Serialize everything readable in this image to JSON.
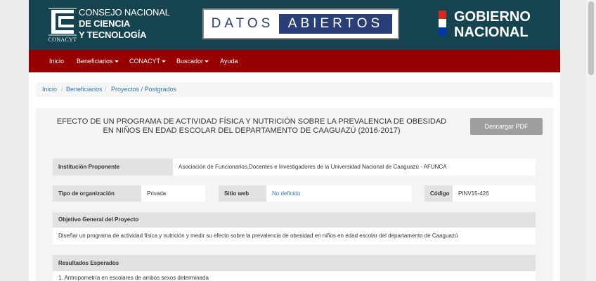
{
  "header": {
    "conacyt": {
      "line1": "CONSEJO NACIONAL",
      "line2": "DE CIENCIA",
      "line3": "Y TECNOLOGÍA",
      "abbr": "CONACYT"
    },
    "datos_abiertos": {
      "datos": "DATOS",
      "abiertos": "ABIERTOS"
    },
    "gobierno": {
      "line1": "GOBIERNO",
      "line2": "NACIONAL"
    }
  },
  "nav": {
    "items": [
      {
        "label": "Inicio",
        "dropdown": false
      },
      {
        "label": "Beneficiarios",
        "dropdown": true
      },
      {
        "label": "CONACYT",
        "dropdown": true
      },
      {
        "label": "Buscador",
        "dropdown": true
      },
      {
        "label": "Ayuda",
        "dropdown": false
      }
    ]
  },
  "breadcrumb": {
    "items": [
      "Inicio",
      "Beneficiarios",
      "Proyectos / Postgrados"
    ],
    "separator": "/"
  },
  "project": {
    "title_line1": "EFECTO DE UN PROGRAMA DE ACTIVIDAD FÍSICA Y NUTRICIÓN SOBRE LA PREVALENCIA DE OBESIDAD",
    "title_line2": "EN NIÑOS EN EDAD ESCOLAR DEL DEPARTAMENTO DE CAAGUAZÚ (2016-2017)",
    "download_label": "Descargar PDF"
  },
  "fields": {
    "institucion": {
      "label": "Institución Proponente",
      "value": "Asociación de Funcionarios,Docentes e Investigadores de la Universidad Nacional de Caaguazú - AFUNCA"
    },
    "tipo": {
      "label": "Tipo de organización",
      "value": "Privada"
    },
    "sitio": {
      "label": "Sitio web",
      "value": "No definido"
    },
    "codigo": {
      "label": "Código",
      "value": "PINV15-426"
    },
    "objetivo": {
      "label": "Objetivo General del Proyecto",
      "value": "Diseñar un programa de actividad física y nutrición y medir su efecto sobre la prevalencia de obesidad en niños en edad escolar del departamento de Caaguazú"
    },
    "resultados": {
      "label": "Resultados Esperados",
      "value": "1. Antropometría en escolares de ambos sexos determinada"
    }
  },
  "colors": {
    "header_bg": "#15434f",
    "navbar_bg": "#960000",
    "link": "#337ab7",
    "datos_blue": "#2a3f78"
  }
}
